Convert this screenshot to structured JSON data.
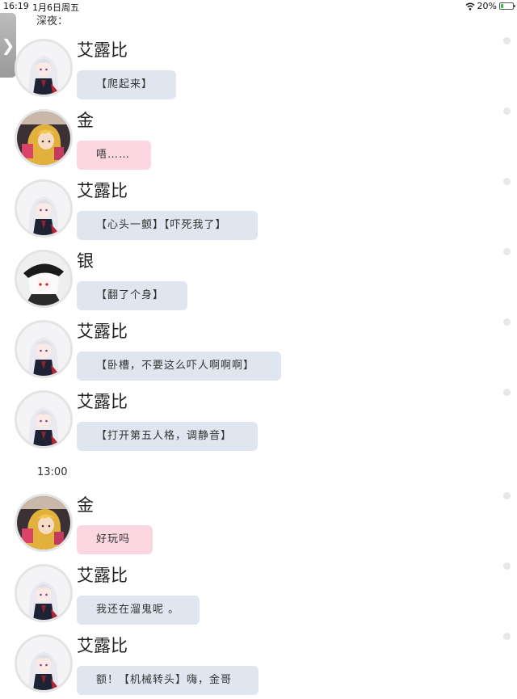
{
  "status_bar": {
    "time": "16:19",
    "date": "1月6日周五",
    "battery": "20%",
    "battery_level": 0.2
  },
  "side_tab": {
    "icon": "chevron-right-icon",
    "glyph": "❯"
  },
  "sections": {
    "night": "深夜：",
    "time_1300": "13:00"
  },
  "messages": [
    {
      "name": "艾露比",
      "text": "【爬起来】",
      "avatar": "ailubi",
      "bubble": "blue"
    },
    {
      "name": "金",
      "text": "唔……",
      "avatar": "jin",
      "bubble": "pink"
    },
    {
      "name": "艾露比",
      "text": "【心头一颤】【吓死我了】",
      "avatar": "ailubi",
      "bubble": "blue"
    },
    {
      "name": "银",
      "text": "【翻了个身】",
      "avatar": "yin",
      "bubble": "blue"
    },
    {
      "name": "艾露比",
      "text": "【卧槽，不要这么吓人啊啊啊】",
      "avatar": "ailubi",
      "bubble": "blue"
    },
    {
      "name": "艾露比",
      "text": "【打开第五人格，调静音】",
      "avatar": "ailubi",
      "bubble": "blue"
    },
    {
      "name": "金",
      "text": "好玩吗",
      "avatar": "jin",
      "bubble": "pink"
    },
    {
      "name": "艾露比",
      "text": "我还在溜鬼呢 。",
      "avatar": "ailubi",
      "bubble": "blue"
    },
    {
      "name": "艾露比",
      "text": "额！【机械转头】嗨，金哥",
      "avatar": "ailubi",
      "bubble": "blue"
    }
  ],
  "colors": {
    "bubble_blue": "#dfe6ef",
    "bubble_pink": "#fcd6e0",
    "background": "#ffffff"
  }
}
